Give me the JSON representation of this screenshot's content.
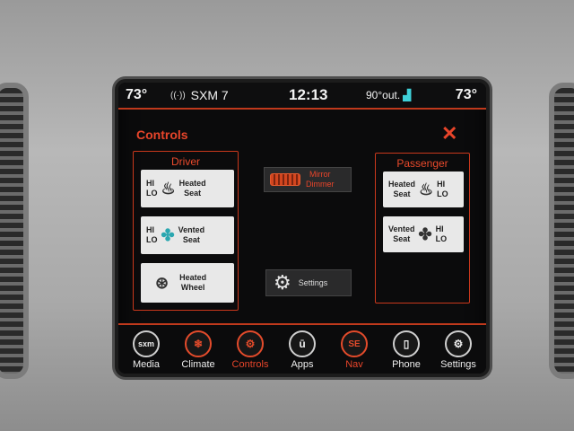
{
  "status": {
    "temp_left": "73°",
    "radio": "SXM 7",
    "clock": "12:13",
    "outside_temp": "90°out.",
    "temp_right": "73°"
  },
  "page": {
    "title": "Controls",
    "close": "✕"
  },
  "driver": {
    "title": "Driver",
    "heated_seat": {
      "hi": "HI",
      "lo": "LO",
      "label_line1": "Heated",
      "label_line2": "Seat"
    },
    "vented_seat": {
      "hi": "HI",
      "lo": "LO",
      "label_line1": "Vented",
      "label_line2": "Seat"
    },
    "heated_wheel": {
      "label_line1": "Heated",
      "label_line2": "Wheel"
    }
  },
  "center": {
    "mirror_line1": "Mirror",
    "mirror_line2": "Dimmer",
    "settings": "Settings"
  },
  "passenger": {
    "title": "Passenger",
    "heated_seat": {
      "hi": "HI",
      "lo": "LO",
      "label_line1": "Heated",
      "label_line2": "Seat"
    },
    "vented_seat": {
      "hi": "HI",
      "lo": "LO",
      "label_line1": "Vented",
      "label_line2": "Seat"
    }
  },
  "nav": [
    {
      "label": "Media",
      "icon_text": "sxm",
      "icon": "sxm-icon",
      "active": false
    },
    {
      "label": "Climate",
      "icon_text": "❄",
      "icon": "climate-icon",
      "active": false
    },
    {
      "label": "Controls",
      "icon_text": "⚙",
      "icon": "controls-icon",
      "active": true
    },
    {
      "label": "Apps",
      "icon_text": "ū",
      "icon": "apps-icon",
      "active": false
    },
    {
      "label": "Nav",
      "icon_text": "SE",
      "icon": "compass-icon",
      "active": false
    },
    {
      "label": "Phone",
      "icon_text": "▯",
      "icon": "phone-icon",
      "active": false
    },
    {
      "label": "Settings",
      "icon_text": "⚙",
      "icon": "gear-icon",
      "active": false
    }
  ],
  "colors": {
    "accent": "#e8452a",
    "background": "#0b0b0c",
    "tile": "#e8e8e8"
  }
}
